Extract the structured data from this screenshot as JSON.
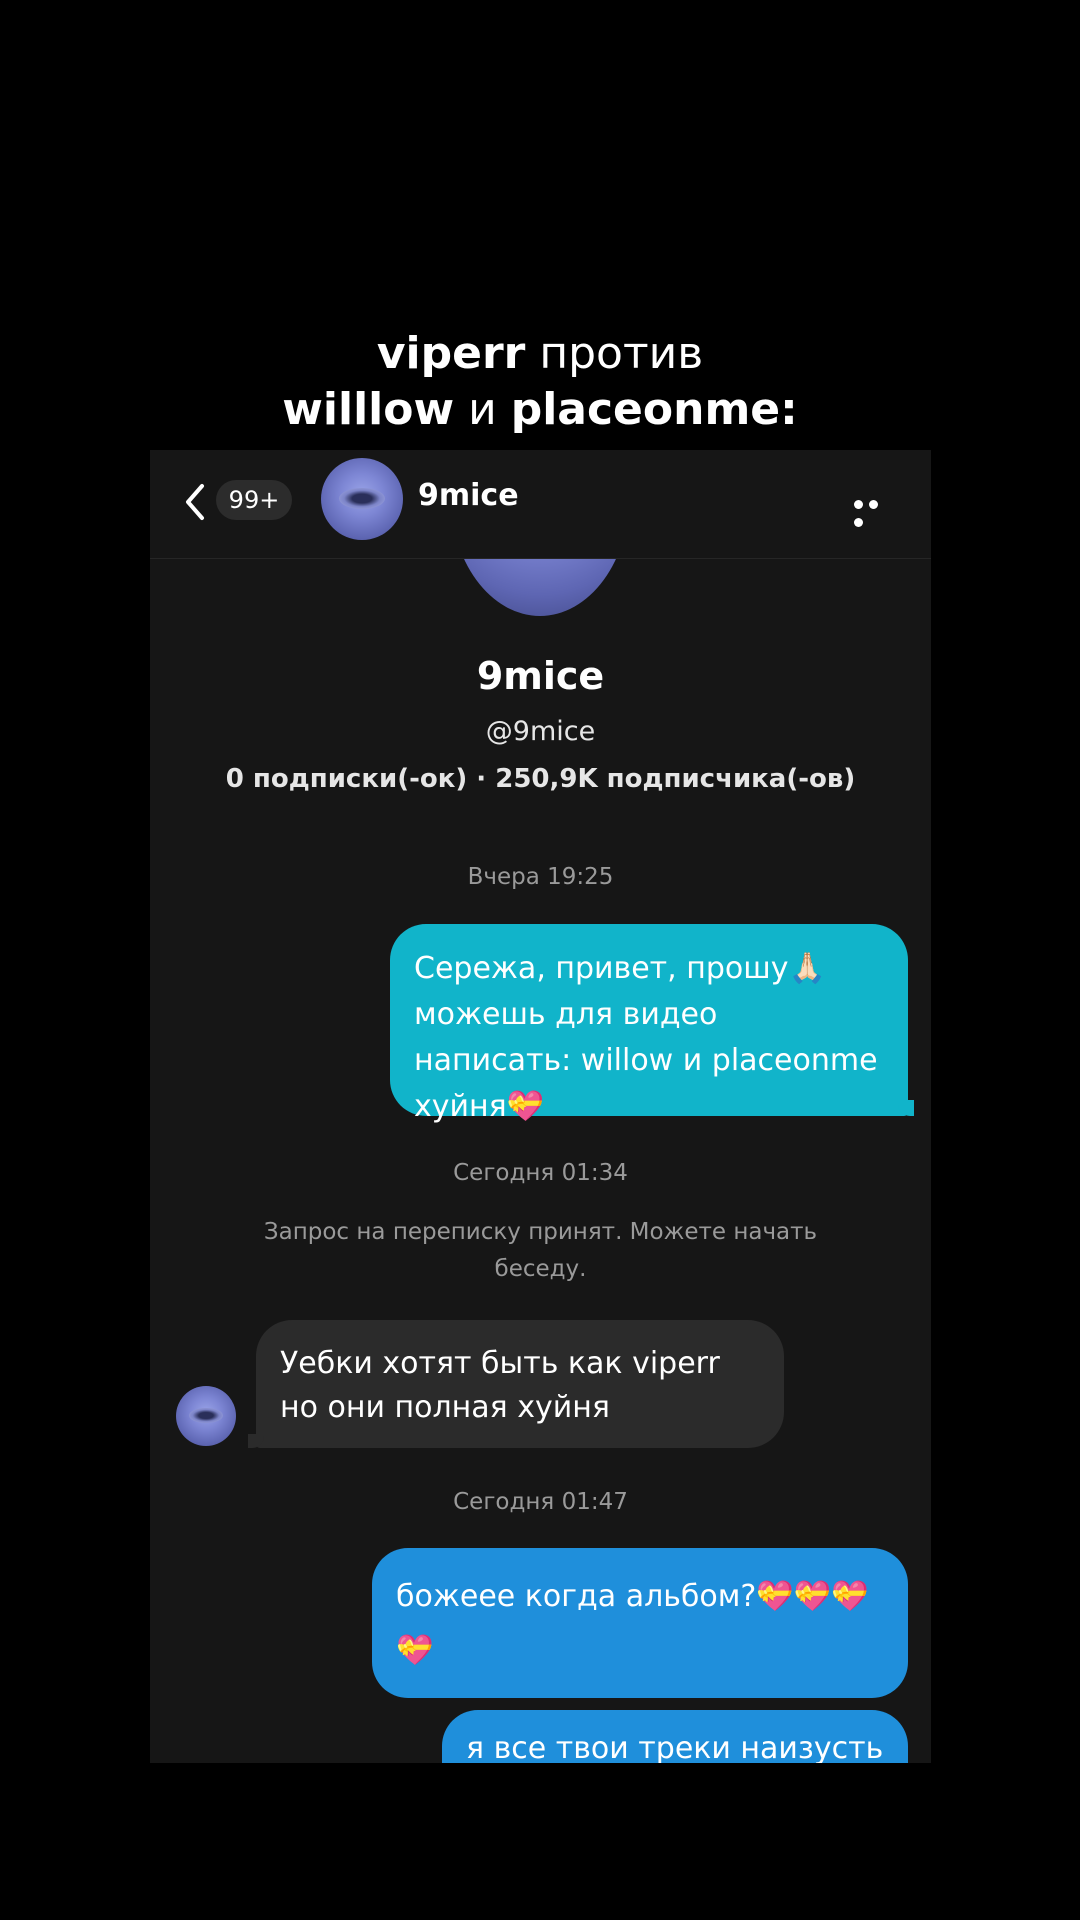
{
  "caption": {
    "line1_bold": "viperr",
    "line1_rest": " против",
    "line2_bold_a": "willlow",
    "line2_mid": " и ",
    "line2_bold_b": "placeonme:"
  },
  "header": {
    "back_icon": "chevron-left-icon",
    "unread_badge": "99+",
    "name": "9mice",
    "more_icon": "more-horizontal-icon"
  },
  "profile": {
    "name": "9mice",
    "handle": "@9mice",
    "stats": "0 подписки(-ок) · 250,9K подписчика(-ов)"
  },
  "chat": {
    "stamp1": "Вчера 19:25",
    "msg1": "Сережа, привет, прошу🙏🏻 можешь для видео написать: willow и placeonme хуйня💝",
    "stamp2": "Сегодня 01:34",
    "system_note": "Запрос на переписку принят. Можете начать беседу.",
    "msg2": "Уебки хотят быть как viperr но они полная хуйня",
    "stamp3": "Сегодня 01:47",
    "msg3": "божеее когда альбом?💝💝💝💝",
    "msg4": "я все твои треки наизусть"
  },
  "colors": {
    "outgoing_first": "#11b4ca",
    "outgoing": "#1f8fdb",
    "incoming": "#2b2b2b",
    "background": "#161616"
  }
}
